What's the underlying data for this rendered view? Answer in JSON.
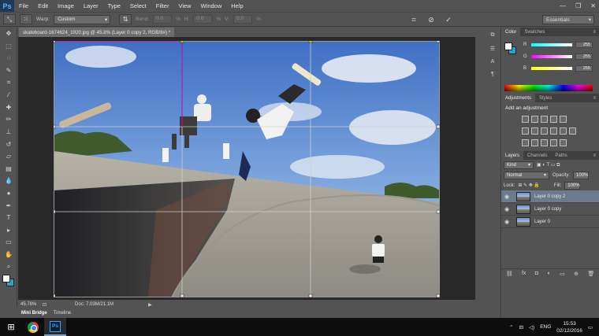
{
  "app": {
    "logo": "Ps"
  },
  "menu": [
    "File",
    "Edit",
    "Image",
    "Layer",
    "Type",
    "Select",
    "Filter",
    "View",
    "Window",
    "Help"
  ],
  "window_controls": {
    "minimize": "—",
    "restore": "❐",
    "close": "✕"
  },
  "options_bar": {
    "warp_label": "Warp:",
    "warp_value": "Custom",
    "bend_label": "Bend:",
    "bend_value": "0.0",
    "h_label": "H:",
    "h_value": "0.0",
    "v_label": "V:",
    "v_value": "0.0",
    "percent": "%",
    "workspace": "Essentials",
    "icons": [
      "move-transform-icon",
      "reference-point-icon",
      "warp-mode-icon",
      "cancel-icon",
      "commit-icon"
    ]
  },
  "tools": [
    "move",
    "marquee",
    "lasso",
    "quick-select",
    "crop",
    "eyedropper",
    "healing",
    "brush",
    "stamp",
    "history-brush",
    "eraser",
    "gradient",
    "blur",
    "dodge",
    "pen",
    "type",
    "path-select",
    "rectangle",
    "hand",
    "zoom"
  ],
  "document": {
    "tab_title": "skateboard-1674624_1920.jpg @ 45.8% (Layer 0 copy 2, RGB/8#) *",
    "tab_close": "×",
    "zoom": "45.78%",
    "doc_info": "Doc: 7.03M/21.1M",
    "status_arrow": "▶"
  },
  "bottom_tabs": [
    "Mini Bridge",
    "Timeline"
  ],
  "color_panel": {
    "tabs": [
      "Color",
      "Swatches"
    ],
    "channels": [
      {
        "label": "R",
        "value": "255"
      },
      {
        "label": "G",
        "value": "255"
      },
      {
        "label": "B",
        "value": "255"
      }
    ],
    "foreground": "#ffffff",
    "background": "#29a2cf"
  },
  "adjustments_panel": {
    "tabs": [
      "Adjustments",
      "Styles"
    ],
    "title": "Add an adjustment"
  },
  "layers_panel": {
    "tabs": [
      "Layers",
      "Channels",
      "Paths"
    ],
    "kind_label": "Kind",
    "blend_mode": "Normal",
    "opacity_label": "Opacity:",
    "opacity_value": "100%",
    "lock_label": "Lock:",
    "fill_label": "Fill:",
    "fill_value": "100%",
    "layers": [
      {
        "name": "Layer 0 copy 2",
        "selected": true
      },
      {
        "name": "Layer 0 copy",
        "selected": false
      },
      {
        "name": "Layer 0",
        "selected": false
      }
    ],
    "footer_icons": [
      "link-icon",
      "fx-icon",
      "mask-icon",
      "adjustment-icon",
      "group-icon",
      "new-layer-icon",
      "trash-icon"
    ]
  },
  "taskbar": {
    "apps": [
      "chrome",
      "photoshop"
    ],
    "ps_label": "Ps",
    "language": "ENG",
    "time": "15:53",
    "date": "02/12/2016"
  },
  "colors": {
    "ui_gray": "#535353",
    "canvas_dark": "#282828",
    "accent_blue": "#29a2cf",
    "selection": "#6a7a8f"
  }
}
